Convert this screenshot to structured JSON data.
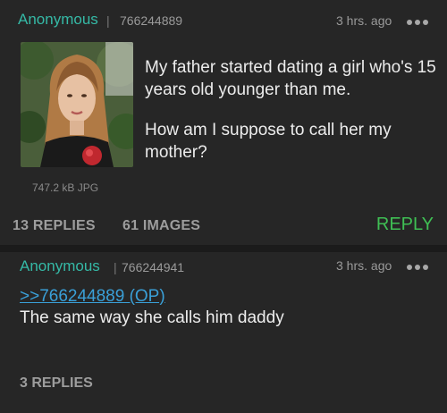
{
  "posts": [
    {
      "author": "Anonymous",
      "separator": "|",
      "id": "766244889",
      "time": "3 hrs. ago",
      "file_size": "747.2 kB JPG",
      "paragraphs": [
        "My father started dating a girl who's 15 years old younger than me.",
        "How am I suppose to call her my mother?"
      ],
      "replies": "13 REPLIES",
      "images": "61 IMAGES",
      "reply_label": "REPLY"
    },
    {
      "author": "Anonymous",
      "separator": "|",
      "id": "766244941",
      "time": "3 hrs. ago",
      "quote": ">>766244889 (OP)",
      "text": "The same way she calls him daddy",
      "replies": "3 REPLIES"
    }
  ],
  "colors": {
    "author": "#35b9a6",
    "reply": "#3fbf54",
    "quote_link": "#3aa0d8",
    "background": "#262626"
  },
  "icons": {
    "more": "three-dots-icon"
  }
}
